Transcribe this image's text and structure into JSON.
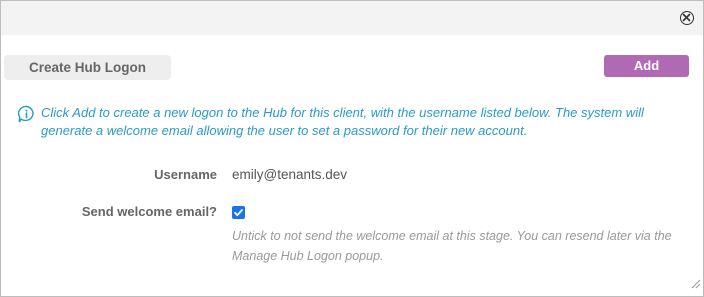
{
  "dialog": {
    "close_icon": "close-circle-icon"
  },
  "header": {
    "title": "Create Hub Logon",
    "add_label": "Add"
  },
  "info": {
    "icon": "info-bubble-icon",
    "text": "Click Add to create a new logon to the Hub for this client, with the username listed below. The system will generate a welcome email allowing the user to set a password for their new account."
  },
  "form": {
    "username_label": "Username",
    "username_value": "emily@tenants.dev",
    "welcome_label": "Send welcome email?",
    "welcome_checked": true,
    "welcome_note": "Untick to not send the welcome email at this stage. You can resend later via the Manage Hub Logon popup."
  },
  "colors": {
    "accent": "#b06ab3",
    "info": "#2a9bc7",
    "checkbox": "#1a73e8"
  }
}
